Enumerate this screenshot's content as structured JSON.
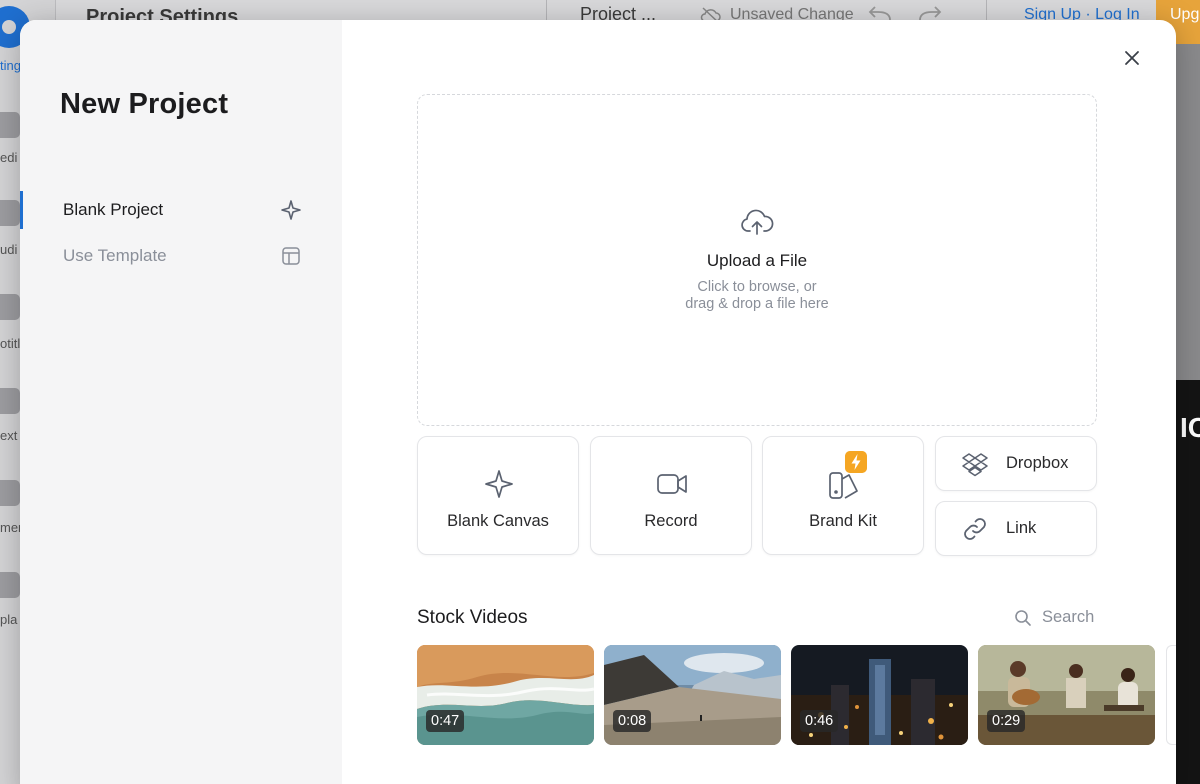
{
  "background": {
    "title": "Project Settings",
    "project_name": "Project ...",
    "save_status": "Unsaved Change",
    "auth": "Sign Up · Log In",
    "upgrade": "Upg",
    "rail": [
      "ting",
      "edi",
      "udi",
      "otitl",
      "ext",
      "men",
      "pla"
    ],
    "dark_text": "IC"
  },
  "modal": {
    "title": "New Project",
    "sidebar": [
      {
        "label": "Blank Project",
        "icon": "sparkle-icon",
        "active": true
      },
      {
        "label": "Use Template",
        "icon": "template-icon",
        "active": false
      }
    ],
    "upload": {
      "title": "Upload a File",
      "subtitle_line1": "Click to browse, or",
      "subtitle_line2": "drag & drop a file here"
    },
    "options": [
      {
        "label": "Blank Canvas",
        "icon": "sparkle-icon"
      },
      {
        "label": "Record",
        "icon": "video-camera-icon"
      },
      {
        "label": "Brand Kit",
        "icon": "brand-kit-icon",
        "badge": "lightning-icon"
      },
      {
        "label": "Dropbox",
        "icon": "dropbox-icon"
      },
      {
        "label": "Link",
        "icon": "link-icon"
      }
    ],
    "stock": {
      "title": "Stock Videos",
      "search_label": "Search",
      "videos": [
        {
          "duration": "0:47",
          "scene": "aerial beach"
        },
        {
          "duration": "0:08",
          "scene": "mountain valley"
        },
        {
          "duration": "0:46",
          "scene": "night city"
        },
        {
          "duration": "0:29",
          "scene": "people with guitar"
        }
      ]
    }
  },
  "colors": {
    "accent": "#1f6fd0",
    "badge": "#f5a623",
    "muted_text": "#8a8f99"
  }
}
